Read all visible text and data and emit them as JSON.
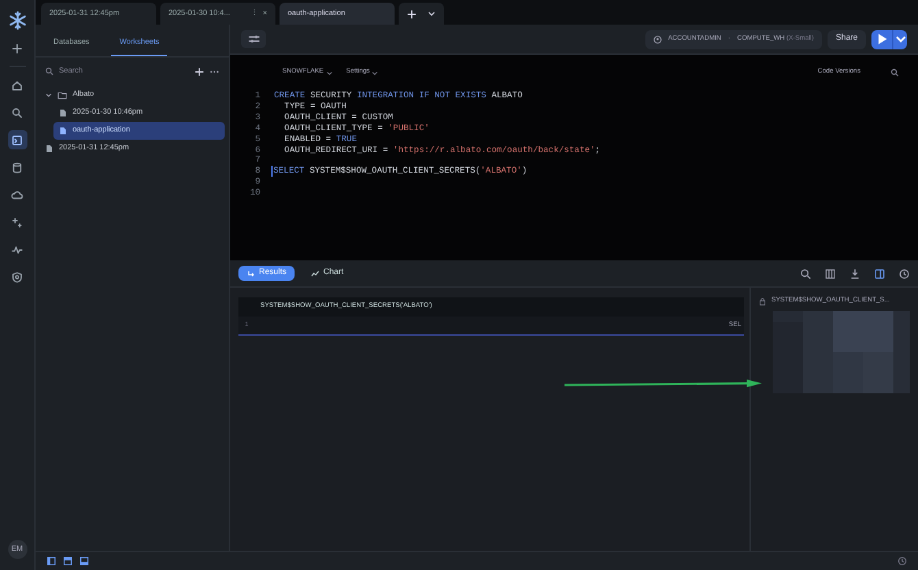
{
  "rail": {
    "items": [
      {
        "kind": "plus",
        "selected": false
      },
      {
        "kind": "home",
        "selected": false
      },
      {
        "kind": "search",
        "selected": false
      },
      {
        "kind": "worksheet",
        "selected": true
      },
      {
        "kind": "database",
        "selected": false
      },
      {
        "kind": "cloud",
        "selected": false
      },
      {
        "kind": "sparkle",
        "selected": false
      },
      {
        "kind": "activity",
        "selected": false
      },
      {
        "kind": "shield",
        "selected": false
      }
    ],
    "avatar": "EM"
  },
  "tabs": [
    {
      "label": "2025-01-31 12:45pm",
      "selected": false
    },
    {
      "label": "2025-01-30 10:4...",
      "selected": false,
      "more": "⋮",
      "close": "×"
    },
    {
      "label": "oauth-application",
      "selected": true
    }
  ],
  "sidebar": {
    "tabs": [
      {
        "label": "Databases",
        "selected": false
      },
      {
        "label": "Worksheets",
        "selected": true
      }
    ],
    "search": {
      "placeholder": "Search"
    },
    "tree": [
      {
        "label": "Albato",
        "kind": "folder",
        "expanded": true,
        "selected": false,
        "children": [
          {
            "label": "2025-01-30 10:46pm",
            "kind": "file",
            "selected": false
          },
          {
            "label": "oauth-application",
            "kind": "file",
            "selected": true
          }
        ]
      },
      {
        "label": "2025-01-31 12:45pm",
        "kind": "file",
        "selected": false
      }
    ]
  },
  "toolbar": {
    "role": "ACCOUNTADMIN",
    "separator": "·",
    "warehouse": "COMPUTE_WH",
    "size": "(X-Small)",
    "share": "Share"
  },
  "editor": {
    "database": "SNOWFLAKE",
    "settings": "Settings",
    "versions": "Code Versions",
    "lines": [
      {
        "number": "1",
        "cursor": false,
        "tokens": [
          {
            "kind": "keyword",
            "text": "CREATE "
          },
          {
            "kind": "plain",
            "text": "SECURITY "
          },
          {
            "kind": "keyword",
            "text": "INTEGRATION IF NOT EXISTS "
          },
          {
            "kind": "plain",
            "text": "ALBATO"
          }
        ]
      },
      {
        "number": "2",
        "cursor": false,
        "tokens": [
          {
            "kind": "plain",
            "text": "  TYPE = OAUTH"
          }
        ]
      },
      {
        "number": "3",
        "cursor": false,
        "tokens": [
          {
            "kind": "plain",
            "text": "  OAUTH_CLIENT = CUSTOM"
          }
        ]
      },
      {
        "number": "4",
        "cursor": false,
        "tokens": [
          {
            "kind": "plain",
            "text": "  OAUTH_CLIENT_TYPE = "
          },
          {
            "kind": "string",
            "text": "'PUBLIC'"
          }
        ]
      },
      {
        "number": "5",
        "cursor": false,
        "tokens": [
          {
            "kind": "plain",
            "text": "  ENABLED = "
          },
          {
            "kind": "keyword",
            "text": "TRUE"
          }
        ]
      },
      {
        "number": "6",
        "cursor": false,
        "tokens": [
          {
            "kind": "plain",
            "text": "  OAUTH_REDIRECT_URI = "
          },
          {
            "kind": "string",
            "text": "'https://r.albato.com/oauth/back/state'"
          },
          {
            "kind": "plain",
            "text": ";"
          }
        ]
      },
      {
        "number": "7",
        "cursor": false
      },
      {
        "number": "8",
        "cursor": true,
        "tokens": [
          {
            "kind": "keyword",
            "text": "SELECT "
          },
          {
            "kind": "plain",
            "text": "SYSTEM$SHOW_OAUTH_CLIENT_SECRETS("
          },
          {
            "kind": "string",
            "text": "'ALBATO'"
          },
          {
            "kind": "plain",
            "text": ")"
          }
        ]
      },
      {
        "number": "9",
        "cursor": false
      },
      {
        "number": "10",
        "cursor": false
      }
    ]
  },
  "results": {
    "tabs": [
      {
        "label": "Results",
        "selected": true
      },
      {
        "label": "Chart",
        "selected": false
      }
    ],
    "table": {
      "columns": [
        "SYSTEM$SHOW_OAUTH_CLIENT_SECRETS('ALBATO')"
      ],
      "rows": [
        {
          "number": "1",
          "cells": [
            "SEL"
          ]
        }
      ]
    },
    "detail": {
      "title": "SYSTEM$SHOW_OAUTH_CLIENT_S..."
    }
  }
}
